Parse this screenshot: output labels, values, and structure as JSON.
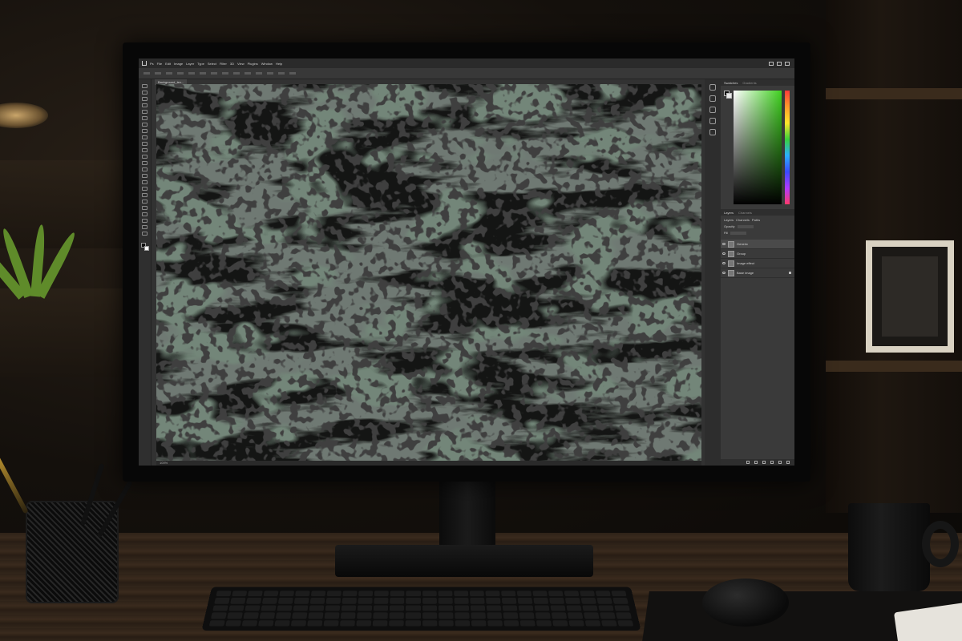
{
  "app": {
    "menus": [
      "Ps",
      "File",
      "Edit",
      "Image",
      "Layer",
      "Type",
      "Select",
      "Filter",
      "3D",
      "View",
      "Plugins",
      "Window",
      "Help"
    ],
    "document_tab": "Background_tex..."
  },
  "canvas": {
    "status": "100%"
  },
  "panels": {
    "color": {
      "tabs": [
        "Swatches",
        "Gradients"
      ],
      "accent": "#3fd01f"
    },
    "layers": {
      "tabs": [
        "Layers",
        "Channels"
      ],
      "subtabs": [
        "Layers",
        "Channels",
        "Paths"
      ],
      "options": [
        "Opacity",
        "Fill"
      ],
      "items": [
        {
          "name": "Generic",
          "locked": false,
          "selected": true
        },
        {
          "name": "Group",
          "locked": false,
          "selected": false
        },
        {
          "name": "Image effect",
          "locked": false,
          "selected": false
        },
        {
          "name": "Base image",
          "locked": true,
          "selected": false
        }
      ]
    }
  },
  "colors": {
    "canvas_dark": "#1a1c1a",
    "moss_green": "#2c3a2e",
    "ui_gray": "#323232"
  }
}
